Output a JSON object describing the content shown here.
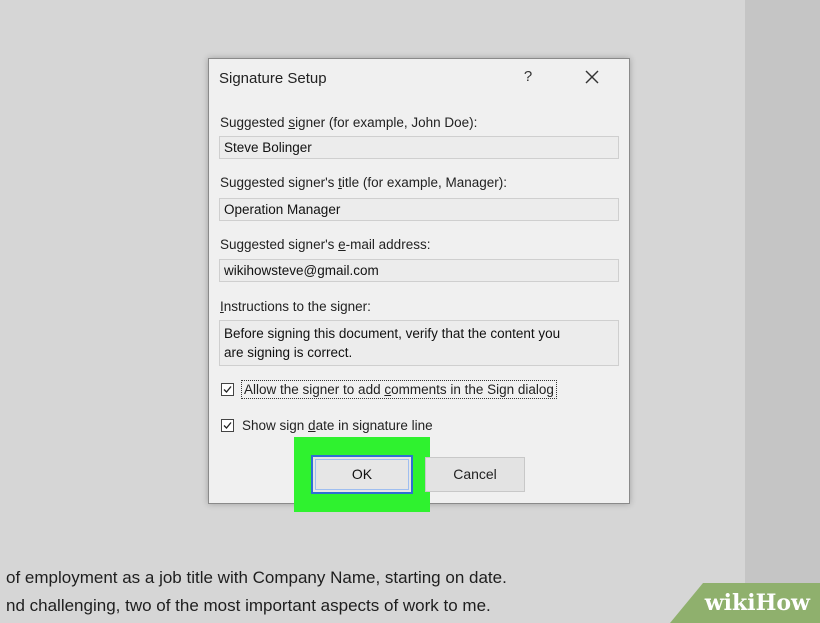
{
  "document": {
    "line1": "of employment as a job title with Company Name, starting on date.",
    "line2": "nd challenging, two of the most important aspects of work to me."
  },
  "watermark": {
    "text": "wikiHow",
    "color": "#8fb06d"
  },
  "dialog": {
    "title": "Signature Setup",
    "help_label": "?",
    "close_icon": "close-icon",
    "fields": [
      {
        "label_pre": "Suggested ",
        "label_u": "s",
        "label_post": "igner (for example, John Doe):",
        "value": "Steve Bolinger"
      },
      {
        "label_pre": "Suggested signer's ",
        "label_u": "t",
        "label_post": "itle (for example, Manager):",
        "value": "Operation Manager"
      },
      {
        "label_pre": "Suggested signer's ",
        "label_u": "e",
        "label_post": "-mail address:",
        "value": "wikihowsteve@gmail.com"
      }
    ],
    "instructions": {
      "label_u": "I",
      "label_post": "nstructions to the signer:",
      "value_line1": "Before signing this document, verify that the content you",
      "value_line2": "are signing is correct."
    },
    "checkboxes": [
      {
        "label_pre": "Allow the signer to add ",
        "label_u": "c",
        "label_post": "omments in the Sign dialog",
        "checked": true
      },
      {
        "label_pre": "Show sign ",
        "label_u": "d",
        "label_post": "ate in signature line",
        "checked": true
      }
    ],
    "ok_label": "OK",
    "cancel_label": "Cancel",
    "highlight_color": "#2ff22f",
    "focus_color": "#2f6fd3"
  }
}
